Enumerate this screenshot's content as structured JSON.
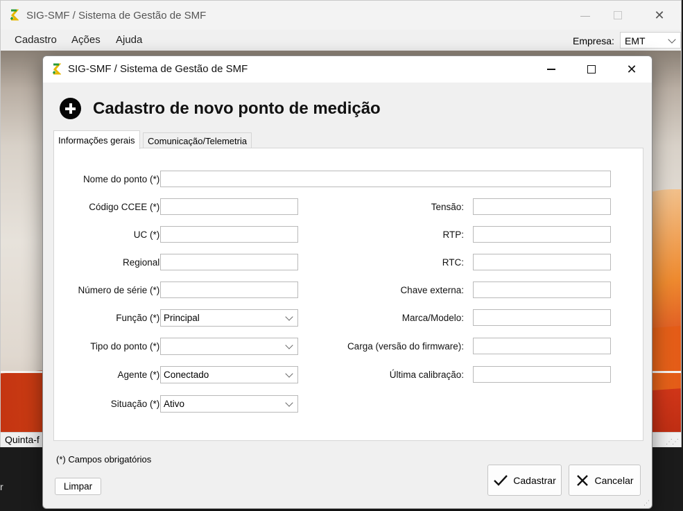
{
  "main_window": {
    "title": "SIG-SMF / Sistema de Gestão de SMF",
    "menu": [
      "Cadastro",
      "Ações",
      "Ajuda"
    ],
    "empresa_label": "Empresa:",
    "empresa_value": "EMT",
    "status_text": "Quinta-f"
  },
  "taskbar_text": "r",
  "dialog": {
    "title": "SIG-SMF / Sistema de Gestão de SMF",
    "heading": "Cadastro de novo ponto de medição",
    "tabs": [
      "Informações gerais",
      "Comunicação/Telemetria"
    ],
    "fields": {
      "nome_do_ponto": {
        "label": "Nome do ponto (*):",
        "value": ""
      },
      "codigo_ccee": {
        "label": "Código CCEE (*):",
        "value": ""
      },
      "uc": {
        "label": "UC (*):",
        "value": ""
      },
      "regional": {
        "label": "Regional:",
        "value": ""
      },
      "numero_serie": {
        "label": "Número de série (*):",
        "value": ""
      },
      "funcao": {
        "label": "Função (*):",
        "value": "Principal"
      },
      "tipo_ponto": {
        "label": "Tipo do ponto (*):",
        "value": ""
      },
      "agente": {
        "label": "Agente (*):",
        "value": "Conectado"
      },
      "situacao": {
        "label": "Situação (*):",
        "value": "Ativo"
      },
      "tensao": {
        "label": "Tensão:",
        "value": ""
      },
      "rtp": {
        "label": "RTP:",
        "value": ""
      },
      "rtc": {
        "label": "RTC:",
        "value": ""
      },
      "chave_externa": {
        "label": "Chave externa:",
        "value": ""
      },
      "marca_modelo": {
        "label": "Marca/Modelo:",
        "value": ""
      },
      "carga_firmware": {
        "label": "Carga (versão do firmware):",
        "value": ""
      },
      "ultima_calibracao": {
        "label": "Última calibração:",
        "value": ""
      }
    },
    "footnote": "(*) Campos obrigatórios",
    "buttons": {
      "limpar": "Limpar",
      "cadastrar": "Cadastrar",
      "cancelar": "Cancelar"
    }
  },
  "icons": {
    "app": "app-logo-icon",
    "heading": "plus-circle-icon",
    "cadastrar": "check-icon",
    "cancelar": "x-icon"
  }
}
